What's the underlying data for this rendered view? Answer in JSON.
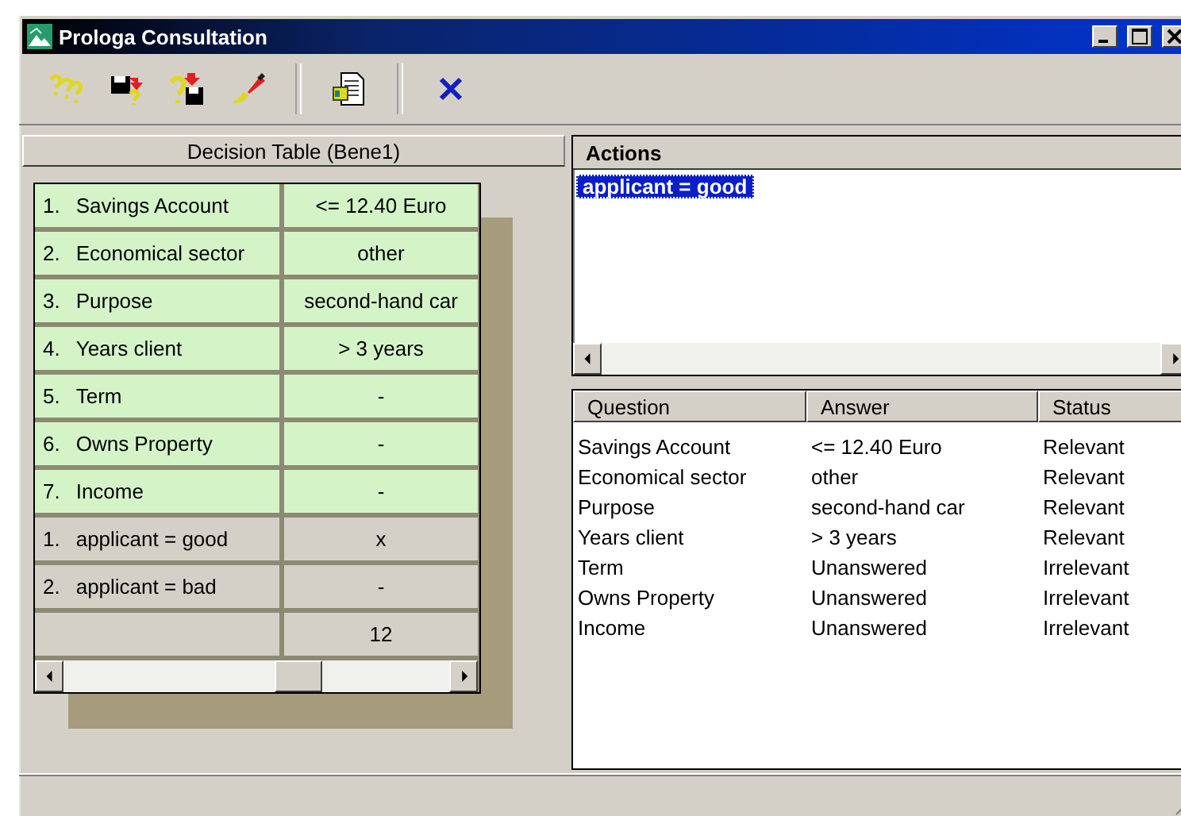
{
  "window": {
    "title": "Prologa Consultation"
  },
  "decision_table": {
    "title": "Decision Table (Bene1)",
    "conditions": [
      {
        "number": "1.",
        "label": "Savings Account",
        "value": "<= 12.40 Euro"
      },
      {
        "number": "2.",
        "label": "Economical sector",
        "value": "other"
      },
      {
        "number": "3.",
        "label": "Purpose",
        "value": "second-hand car"
      },
      {
        "number": "4.",
        "label": "Years client",
        "value": "> 3 years"
      },
      {
        "number": "5.",
        "label": "Term",
        "value": "-"
      },
      {
        "number": "6.",
        "label": "Owns Property",
        "value": "-"
      },
      {
        "number": "7.",
        "label": "Income",
        "value": "-"
      }
    ],
    "actions": [
      {
        "number": "1.",
        "label": "applicant = good",
        "value": "x"
      },
      {
        "number": "2.",
        "label": "applicant = bad",
        "value": "-"
      }
    ],
    "rule_number": "12"
  },
  "actions_pane": {
    "title": "Actions",
    "items": [
      {
        "label": "applicant = good",
        "selected": true
      }
    ]
  },
  "question_list": {
    "columns": [
      "Question",
      "Answer",
      "Status"
    ],
    "rows": [
      {
        "question": "Savings Account",
        "answer": "<= 12.40 Euro",
        "status": "Relevant"
      },
      {
        "question": "Economical sector",
        "answer": "other",
        "status": "Relevant"
      },
      {
        "question": "Purpose",
        "answer": "second-hand car",
        "status": "Relevant"
      },
      {
        "question": "Years client",
        "answer": "> 3 years",
        "status": "Relevant"
      },
      {
        "question": "Term",
        "answer": "Unanswered",
        "status": "Irrelevant"
      },
      {
        "question": "Owns Property",
        "answer": "Unanswered",
        "status": "Irrelevant"
      },
      {
        "question": "Income",
        "answer": "Unanswered",
        "status": "Irrelevant"
      }
    ]
  }
}
